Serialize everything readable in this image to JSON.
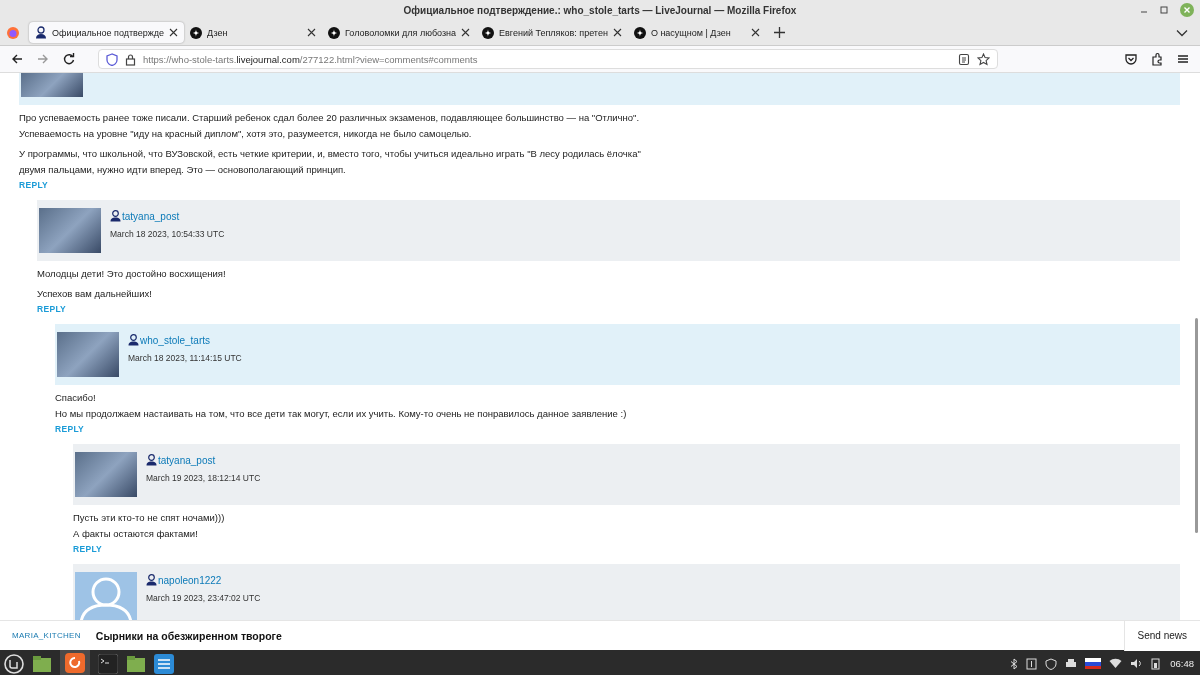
{
  "window": {
    "title": "Официальное подтверждение.: who_stole_tarts — LiveJournal — Mozilla Firefox"
  },
  "tabs": [
    {
      "label": "Официальное подтвержде",
      "selected": true,
      "kind": "user"
    },
    {
      "label": "Дзен",
      "selected": false,
      "kind": "site"
    },
    {
      "label": "Головоломки для любозна",
      "selected": false,
      "kind": "site"
    },
    {
      "label": "Евгений Тепляков: претен",
      "selected": false,
      "kind": "site"
    },
    {
      "label": "О насущном | Дзен",
      "selected": false,
      "kind": "site"
    }
  ],
  "address_bar": {
    "url_prefix": "https://who-stole-tarts.",
    "url_domain": "livejournal.com",
    "url_rest": "/277122.html?view=comments#comments"
  },
  "comments": [
    {
      "color": "#e1f1f9",
      "kind": "photo",
      "paragraphs": [
        "Про успеваемость ранее тоже писали. Старший ребенок сдал более 20 различных экзаменов, подавляющее большинство — на \"Отлично\".\nУспеваемость на уровне \"иду на красный диплом\", хотя это, разумеется, никогда не было самоцелью.",
        "У программы, что школьной, что ВУЗовской, есть четкие критерии, и, вместо того, чтобы учиться идеально играть \"В лесу родилась ёлочка\"\nдвумя пальцами, нужно идти вперед. Это — основополагающий принцип."
      ],
      "reply": "REPLY",
      "children": [
        {
          "color": "#eceff2",
          "kind": "photo",
          "user": "tatyana_post",
          "date": "March 18 2023, 10:54:33 UTC",
          "paragraphs": [
            "Молодцы дети! Это достойно восхищения!",
            "Успехов вам дальнейших!"
          ],
          "reply": "REPLY",
          "children": [
            {
              "color": "#e1f1f9",
              "kind": "photo",
              "user": "who_stole_tarts",
              "date": "March 18 2023, 11:14:15 UTC",
              "paragraphs": [
                "Спасибо!\nНо мы продолжаем настаивать на том, что все дети так могут, если их учить. Кому-то очень не понравилось данное заявление :)"
              ],
              "reply": "REPLY",
              "children": [
                {
                  "color": "#eceff2",
                  "kind": "photo",
                  "user": "tatyana_post",
                  "date": "March 19 2023, 18:12:14 UTC",
                  "paragraphs": [
                    "Пусть эти кто-то не спят ночами)))\nА факты остаются фактами!"
                  ],
                  "reply": "REPLY"
                },
                {
                  "color": "#eceff2",
                  "kind": "default",
                  "user": "napoleon1222",
                  "date": "March 19 2023, 23:47:02 UTC"
                }
              ]
            }
          ]
        }
      ]
    }
  ],
  "news_bar": {
    "source": "MARIA_KITCHEN",
    "headline": "Сырники на обезжиренном твороге",
    "button": "Send news"
  },
  "taskbar": {
    "clock": "06:48"
  }
}
